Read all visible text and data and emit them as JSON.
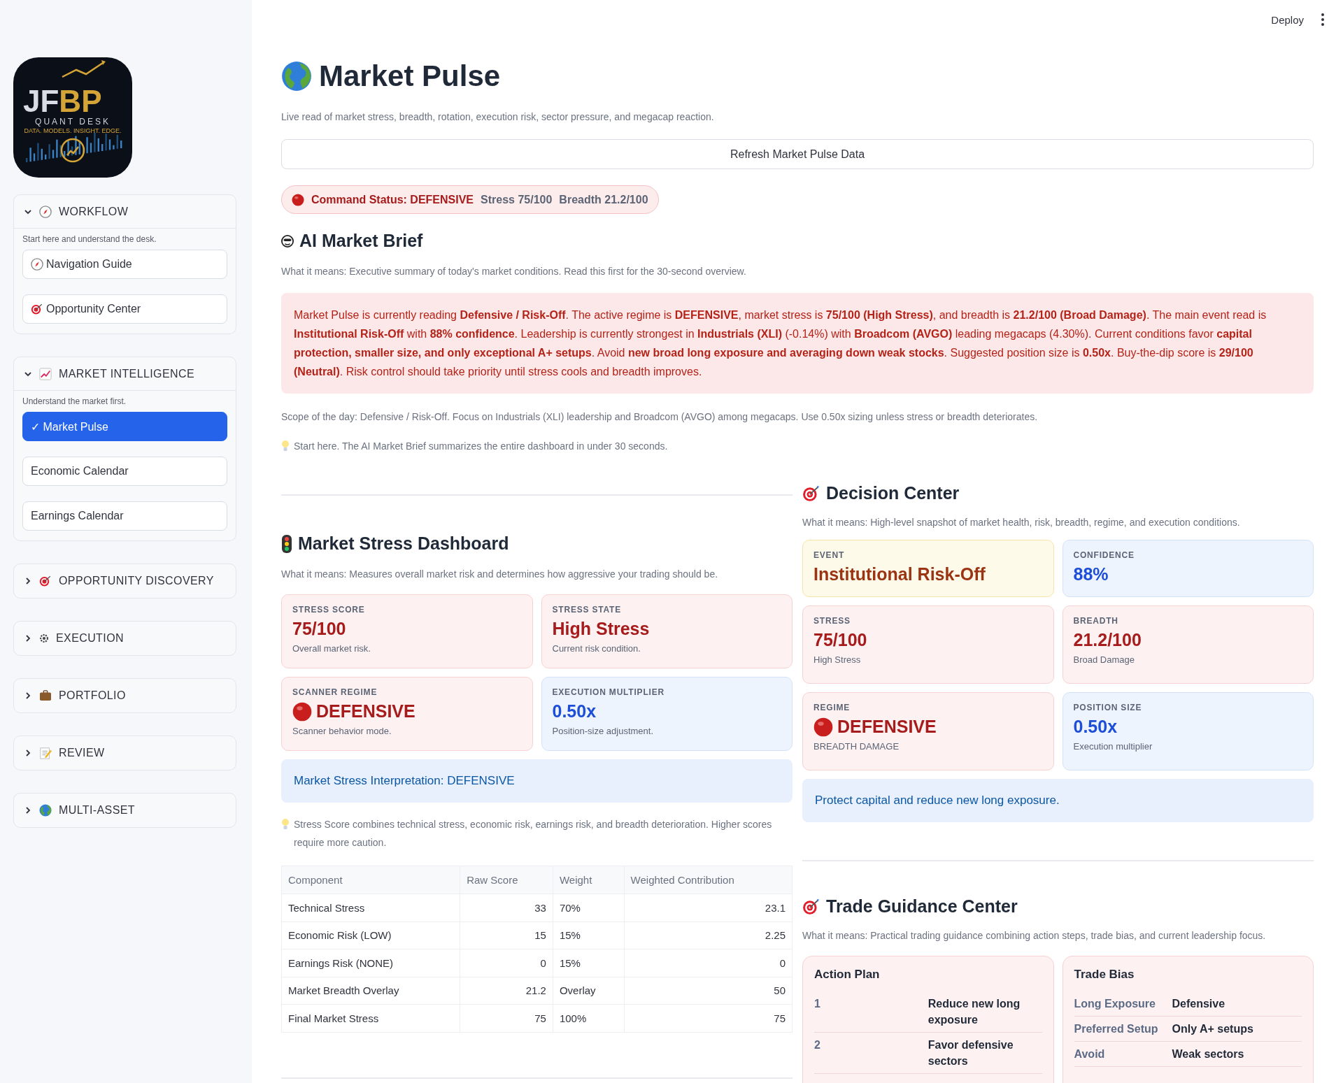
{
  "logo": {
    "title_left": "JF",
    "title_right": "BP",
    "subtitle": "QUANT DESK",
    "tagline": "DATA. MODELS. INSIGHT. EDGE."
  },
  "sidebar": {
    "sections": [
      {
        "label": "WORKFLOW",
        "expanded": true,
        "caption": "Start here and understand the desk.",
        "items": [
          {
            "label": "Navigation Guide",
            "selected": false
          },
          {
            "label": "Opportunity Center",
            "selected": false
          }
        ]
      },
      {
        "label": "MARKET INTELLIGENCE",
        "expanded": true,
        "caption": "Understand the market first.",
        "items": [
          {
            "label": "✓ Market Pulse",
            "selected": true
          },
          {
            "label": "Economic Calendar",
            "selected": false
          },
          {
            "label": "Earnings Calendar",
            "selected": false
          }
        ]
      },
      {
        "label": "OPPORTUNITY DISCOVERY",
        "expanded": false
      },
      {
        "label": "EXECUTION",
        "expanded": false
      },
      {
        "label": "PORTFOLIO",
        "expanded": false
      },
      {
        "label": "REVIEW",
        "expanded": false
      },
      {
        "label": "MULTI-ASSET",
        "expanded": false
      }
    ]
  },
  "header": {
    "deploy": "Deploy"
  },
  "page": {
    "title": "Market Pulse",
    "subtitle": "Live read of market stress, breadth, rotation, execution risk, sector pressure, and megacap reaction.",
    "refresh_button": "Refresh Market Pulse Data"
  },
  "status": {
    "label": "Command Status: DEFENSIVE",
    "stress": "Stress 75/100",
    "breadth": "Breadth 21.2/100"
  },
  "brief": {
    "title": "AI Market Brief",
    "meaning": "What it means: Executive summary of today's market conditions. Read this first for the 30-second overview.",
    "text": "Market Pulse is currently reading **Defensive / Risk-Off**. The active regime is **DEFENSIVE**, market stress is **75/100 (High Stress)**, and breadth is **21.2/100 (Broad Damage)**. The main event read is **Institutional Risk-Off** with **88% confidence**. Leadership is currently strongest in **Industrials (XLI)** (-0.14%) with **Broadcom (AVGO)** leading megacaps (4.30%). Current conditions favor **capital protection, smaller size, and only exceptional A+ setups**. Avoid **new broad long exposure and averaging down weak stocks**. Suggested position size is **0.50x**. Buy-the-dip score is **29/100 (Neutral)**. Risk control should take priority until stress cools and breadth improves.",
    "scope": "Scope of the day: Defensive / Risk-Off. Focus on Industrials (XLI) leadership and Broadcom (AVGO) among megacaps. Use 0.50x sizing unless stress or breadth deteriorates.",
    "tip": "Start here. The AI Market Brief summarizes the entire dashboard in under 30 seconds."
  },
  "stress_dashboard": {
    "title": "Market Stress Dashboard",
    "meaning": "What it means: Measures overall market risk and determines how aggressive your trading should be.",
    "cards": [
      {
        "kind": "danger",
        "label": "STRESS SCORE",
        "value": "75/100",
        "note": "Overall market risk.",
        "dot": false
      },
      {
        "kind": "danger",
        "label": "STRESS STATE",
        "value": "High Stress",
        "note": "Current risk condition.",
        "dot": false
      },
      {
        "kind": "danger",
        "label": "SCANNER REGIME",
        "value": "DEFENSIVE",
        "note": "Scanner behavior mode.",
        "dot": true
      },
      {
        "kind": "info",
        "label": "EXECUTION MULTIPLIER",
        "value": "0.50x",
        "note": "Position-size adjustment.",
        "dot": false
      }
    ],
    "interpretation": "Market Stress Interpretation: DEFENSIVE",
    "tip": "Stress Score combines technical stress, economic risk, earnings risk, and breadth deterioration. Higher scores require more caution.",
    "table": {
      "columns": [
        "Component",
        "Raw Score",
        "Weight",
        "Weighted Contribution"
      ],
      "rows": [
        [
          "Technical Stress",
          "33",
          "70%",
          "23.1"
        ],
        [
          "Economic Risk (LOW)",
          "15",
          "15%",
          "2.25"
        ],
        [
          "Earnings Risk (NONE)",
          "0",
          "15%",
          "0"
        ],
        [
          "Market Breadth Overlay",
          "21.2",
          "Overlay",
          "50"
        ],
        [
          "Final Market Stress",
          "75",
          "100%",
          "75"
        ]
      ]
    }
  },
  "decision_center": {
    "title": "Decision Center",
    "meaning": "What it means: High-level snapshot of market health, risk, breadth, regime, and execution conditions.",
    "cards": [
      {
        "kind": "warning",
        "label": "EVENT",
        "value": "Institutional Risk-Off",
        "dot": false
      },
      {
        "kind": "info",
        "label": "CONFIDENCE",
        "value": "88%",
        "dot": false
      },
      {
        "kind": "danger",
        "label": "STRESS",
        "value": "75/100",
        "note": "High Stress",
        "dot": false
      },
      {
        "kind": "danger",
        "label": "BREADTH",
        "value": "21.2/100",
        "note": "Broad Damage",
        "dot": false
      },
      {
        "kind": "danger",
        "label": "REGIME",
        "value": "DEFENSIVE",
        "note": "BREADTH DAMAGE",
        "dot": true
      },
      {
        "kind": "info",
        "label": "POSITION SIZE",
        "value": "0.50x",
        "note": "Execution multiplier",
        "dot": false
      }
    ],
    "message": "Protect capital and reduce new long exposure."
  },
  "trade_guidance": {
    "title": "Trade Guidance Center",
    "meaning": "What it means: Practical trading guidance combining action steps, trade bias, and current leadership focus.",
    "action_plan": {
      "title": "Action Plan",
      "rows": [
        {
          "number": "1",
          "text": "Reduce new long exposure"
        },
        {
          "number": "2",
          "text": "Favor defensive sectors"
        }
      ]
    },
    "trade_bias": {
      "title": "Trade Bias",
      "rows": [
        {
          "label": "Long Exposure",
          "value": "Defensive"
        },
        {
          "label": "Preferred Setup",
          "value": "Only A+ setups"
        },
        {
          "label": "Avoid",
          "value": "Weak sectors"
        }
      ]
    }
  }
}
